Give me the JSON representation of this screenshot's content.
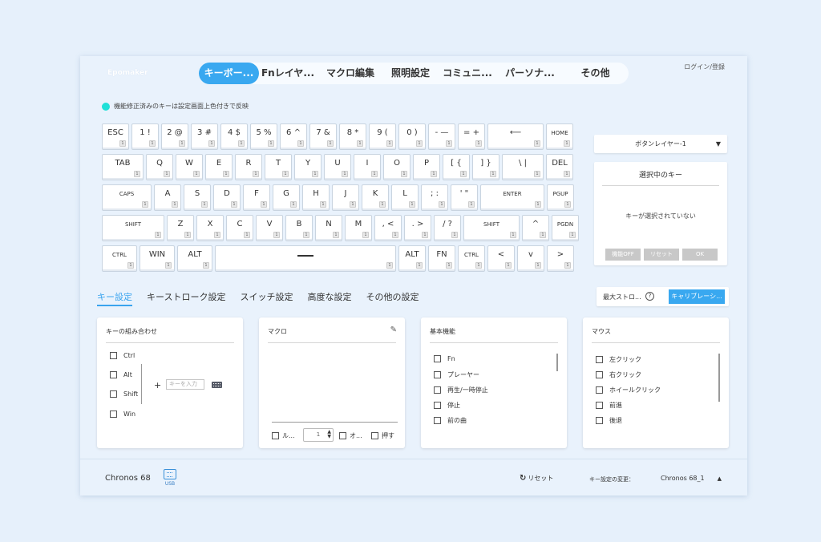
{
  "brand": "Epomaker",
  "nav": {
    "tabs": [
      {
        "label": "キーボー..."
      },
      {
        "label": "Fnレイヤ..."
      },
      {
        "label": "マクロ編集"
      },
      {
        "label": "照明設定"
      },
      {
        "label": "コミュニ..."
      },
      {
        "label": "パーソナ..."
      },
      {
        "label": "その他"
      }
    ],
    "login": "ログイン/登録"
  },
  "notice": "機能修正済みのキーは設定画面上色付きで反映",
  "keyboard": {
    "rows": [
      [
        {
          "label": "ESC",
          "sub": "1"
        },
        {
          "label": "1 !",
          "sub": "1"
        },
        {
          "label": "2 @",
          "sub": "1"
        },
        {
          "label": "3 #",
          "sub": "1"
        },
        {
          "label": "4 $",
          "sub": "1"
        },
        {
          "label": "5 %",
          "sub": "1"
        },
        {
          "label": "6 ^",
          "sub": "1"
        },
        {
          "label": "7 &",
          "sub": "1"
        },
        {
          "label": "8 *",
          "sub": "1"
        },
        {
          "label": "9 (",
          "sub": "1"
        },
        {
          "label": "0 )",
          "sub": "1"
        },
        {
          "label": "- —",
          "sub": "1"
        },
        {
          "label": "= +",
          "sub": "1"
        },
        {
          "label": "⟵",
          "sub": "1"
        },
        {
          "label": "HOME",
          "sub": "1"
        }
      ],
      [
        {
          "label": "TAB",
          "sub": "1"
        },
        {
          "label": "Q",
          "sub": "1"
        },
        {
          "label": "W",
          "sub": "1"
        },
        {
          "label": "E",
          "sub": "1"
        },
        {
          "label": "R",
          "sub": "1"
        },
        {
          "label": "T",
          "sub": "1"
        },
        {
          "label": "Y",
          "sub": "1"
        },
        {
          "label": "U",
          "sub": "1"
        },
        {
          "label": "I",
          "sub": "1"
        },
        {
          "label": "O",
          "sub": "1"
        },
        {
          "label": "P",
          "sub": "1"
        },
        {
          "label": "[ {",
          "sub": "1"
        },
        {
          "label": "] }",
          "sub": "1"
        },
        {
          "label": "\\ |",
          "sub": "1"
        },
        {
          "label": "DEL",
          "sub": "1"
        }
      ],
      [
        {
          "label": "CAPS",
          "sub": "1"
        },
        {
          "label": "A",
          "sub": "1"
        },
        {
          "label": "S",
          "sub": "1"
        },
        {
          "label": "D",
          "sub": "1"
        },
        {
          "label": "F",
          "sub": "1"
        },
        {
          "label": "G",
          "sub": "1"
        },
        {
          "label": "H",
          "sub": "1"
        },
        {
          "label": "J",
          "sub": "1"
        },
        {
          "label": "K",
          "sub": "1"
        },
        {
          "label": "L",
          "sub": "1"
        },
        {
          "label": "; :",
          "sub": "1"
        },
        {
          "label": "' \"",
          "sub": "1"
        },
        {
          "label": "ENTER",
          "sub": "1"
        },
        {
          "label": "PGUP",
          "sub": "1"
        }
      ],
      [
        {
          "label": "SHIFT",
          "sub": "1"
        },
        {
          "label": "Z",
          "sub": "1"
        },
        {
          "label": "X",
          "sub": "1"
        },
        {
          "label": "C",
          "sub": "1"
        },
        {
          "label": "V",
          "sub": "1"
        },
        {
          "label": "B",
          "sub": "1"
        },
        {
          "label": "N",
          "sub": "1"
        },
        {
          "label": "M",
          "sub": "1"
        },
        {
          "label": ", <",
          "sub": "1"
        },
        {
          "label": ". >",
          "sub": "1"
        },
        {
          "label": "/ ?",
          "sub": "1"
        },
        {
          "label": "SHIFT",
          "sub": "1"
        },
        {
          "label": "^",
          "sub": "1"
        },
        {
          "label": "PGDN",
          "sub": "1"
        }
      ],
      [
        {
          "label": "CTRL",
          "sub": "1"
        },
        {
          "label": "WIN",
          "sub": "1"
        },
        {
          "label": "ALT",
          "sub": "1"
        },
        {
          "label": "",
          "sub": "1"
        },
        {
          "label": "ALT",
          "sub": "1"
        },
        {
          "label": "FN",
          "sub": "1"
        },
        {
          "label": "CTRL",
          "sub": "1"
        },
        {
          "label": "<",
          "sub": "1"
        },
        {
          "label": "v",
          "sub": "1"
        },
        {
          "label": ">",
          "sub": "1"
        }
      ]
    ]
  },
  "layer_select": {
    "value": "ボタンレイヤー-1"
  },
  "selected_panel": {
    "title": "選択中のキー",
    "empty": "キーが選択されていない",
    "btn_off": "機能OFF",
    "btn_reset": "リセット",
    "btn_ok": "OK"
  },
  "subtabs": [
    "キー設定",
    "キーストローク設定",
    "スイッチ設定",
    "高度な設定",
    "その他の設定"
  ],
  "max_stroke": {
    "label": "最大ストロ...",
    "help": "?",
    "calibrate": "キャリブレーシ..."
  },
  "combo_card": {
    "title": "キーの組み合わせ",
    "items": [
      "Ctrl",
      "Alt",
      "Shift",
      "Win"
    ],
    "plus": "+",
    "placeholder": "キーを入力"
  },
  "macro_card": {
    "title": "マクロ",
    "loop": "ル...",
    "count": "1",
    "opt": "オ...",
    "press": "押す"
  },
  "basic_card": {
    "title": "基本機能",
    "items": [
      "Fn",
      "プレーヤー",
      "再生/一時停止",
      "停止",
      "前の曲"
    ]
  },
  "mouse_card": {
    "title": "マウス",
    "items": [
      "左クリック",
      "右クリック",
      "ホイールクリック",
      "前進",
      "後退"
    ]
  },
  "footer": {
    "device": "Chronos 68",
    "usb": "USB",
    "reset": "リセット",
    "change_label": "キー設定の変更：",
    "profile": "Chronos 68_1"
  }
}
